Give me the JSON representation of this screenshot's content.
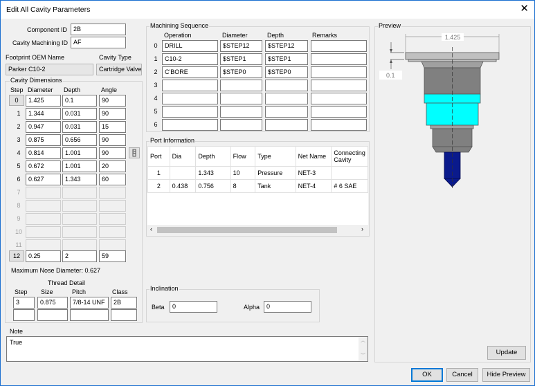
{
  "window": {
    "title": "Edit All Cavity Parameters",
    "close_glyph": "✕"
  },
  "component": {
    "id_label": "Component ID",
    "id_value": "2B",
    "mach_label": "Cavity Machining ID",
    "mach_value": "AF"
  },
  "footprint": {
    "label": "Footprint OEM Name",
    "value": "Parker C10-2",
    "type_label": "Cavity Type",
    "type_value": "Cartridge Valve"
  },
  "cavity": {
    "title": "Cavity Dimensions",
    "headers": {
      "step": "Step",
      "diameter": "Diameter",
      "depth": "Depth",
      "angle": "Angle"
    },
    "rows": [
      {
        "step": "0",
        "diameter": "1.425",
        "depth": "0.1",
        "angle": "90"
      },
      {
        "step": "1",
        "diameter": "1.344",
        "depth": "0.031",
        "angle": "90"
      },
      {
        "step": "2",
        "diameter": "0.947",
        "depth": "0.031",
        "angle": "15"
      },
      {
        "step": "3",
        "diameter": "0.875",
        "depth": "0.656",
        "angle": "90"
      },
      {
        "step": "4",
        "diameter": "0.814",
        "depth": "1.001",
        "angle": "90"
      },
      {
        "step": "5",
        "diameter": "0.672",
        "depth": "1.001",
        "angle": "20"
      },
      {
        "step": "6",
        "diameter": "0.627",
        "depth": "1.343",
        "angle": "60"
      },
      {
        "step": "7",
        "diameter": "",
        "depth": "",
        "angle": ""
      },
      {
        "step": "8",
        "diameter": "",
        "depth": "",
        "angle": ""
      },
      {
        "step": "9",
        "diameter": "",
        "depth": "",
        "angle": ""
      },
      {
        "step": "10",
        "diameter": "",
        "depth": "",
        "angle": ""
      },
      {
        "step": "11",
        "diameter": "",
        "depth": "",
        "angle": ""
      },
      {
        "step": "12",
        "diameter": "0.25",
        "depth": "2",
        "angle": "59"
      }
    ],
    "max_nose": "Maximum Nose Diameter: 0.627"
  },
  "thread": {
    "title": "Thread Detail",
    "headers": {
      "step": "Step",
      "size": "Size",
      "pitch": "Pitch",
      "class": "Class"
    },
    "row1": {
      "step": "3",
      "size": "0.875",
      "pitch": "7/8-14 UNF",
      "class": "2B"
    }
  },
  "machining": {
    "title": "Machining Sequence",
    "headers": {
      "operation": "Operation",
      "diameter": "Diameter",
      "depth": "Depth",
      "remarks": "Remarks"
    },
    "rows": [
      {
        "idx": "0",
        "operation": "DRILL",
        "diameter": "$STEP12",
        "depth": "$STEP12",
        "remarks": ""
      },
      {
        "idx": "1",
        "operation": "C10-2",
        "diameter": "$STEP1",
        "depth": "$STEP1",
        "remarks": ""
      },
      {
        "idx": "2",
        "operation": "C'BORE",
        "diameter": "$STEP0",
        "depth": "$STEP0",
        "remarks": ""
      },
      {
        "idx": "3",
        "operation": "",
        "diameter": "",
        "depth": "",
        "remarks": ""
      },
      {
        "idx": "4",
        "operation": "",
        "diameter": "",
        "depth": "",
        "remarks": ""
      },
      {
        "idx": "5",
        "operation": "",
        "diameter": "",
        "depth": "",
        "remarks": ""
      },
      {
        "idx": "6",
        "operation": "",
        "diameter": "",
        "depth": "",
        "remarks": ""
      }
    ]
  },
  "port": {
    "title": "Port Information",
    "headers": {
      "port": "Port",
      "dia": "Dia",
      "depth": "Depth",
      "flow": "Flow",
      "type": "Type",
      "net": "Net Name",
      "cavity": "Connecting Cavity"
    },
    "rows": [
      {
        "port": "1",
        "dia": "",
        "depth": "1.343",
        "flow": "10",
        "type": "Pressure",
        "net": "NET-3",
        "cavity": ""
      },
      {
        "port": "2",
        "dia": "0.438",
        "depth": "0.756",
        "flow": "8",
        "type": "Tank",
        "net": "NET-4",
        "cavity": "# 6 SAE"
      }
    ]
  },
  "inclination": {
    "title": "Inclination",
    "beta_label": "Beta",
    "beta_value": "0",
    "alpha_label": "Alpha",
    "alpha_value": "0"
  },
  "note": {
    "title": "Note",
    "value": "True"
  },
  "preview": {
    "title": "Preview",
    "dim_top": "1.425",
    "dim_left": "0.1",
    "update_label": "Update"
  },
  "buttons": {
    "ok": "OK",
    "cancel": "Cancel",
    "hide_preview": "Hide Preview"
  },
  "colors": {
    "cyan": "#00ffff",
    "navy": "#0a1a8c",
    "steel": "#808080",
    "light_steel": "#c0c0c0"
  }
}
